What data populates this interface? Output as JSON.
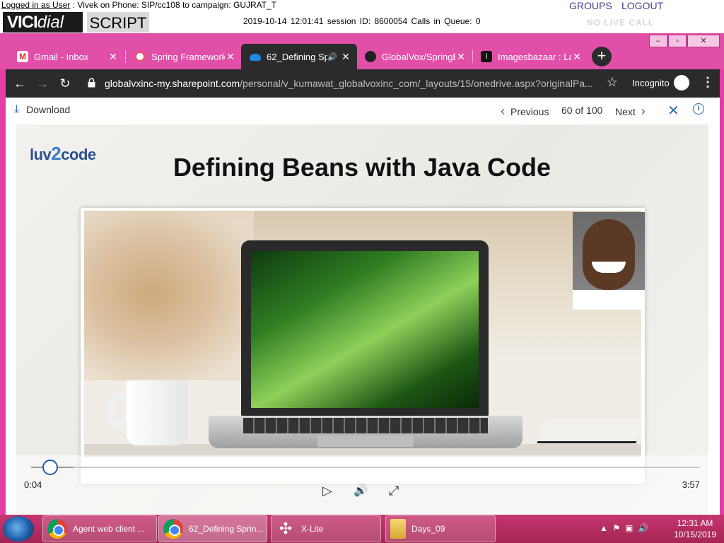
{
  "vici": {
    "logged_label": "Logged in as User",
    "logged_rest": " : Vivek on Phone: SIP/cc108  to campaign: GUJRAT_T",
    "logo_a": "VICI",
    "logo_b": "dial",
    "script_label": "SCRIPT",
    "status_line": "2019-10-14 12:01:41   session ID: 8600054   Calls in Queue: 0",
    "groups": "GROUPS",
    "logout": "LOGOUT",
    "no_live_call": "NO LIVE CALL"
  },
  "chrome": {
    "tabs": [
      {
        "label": "Gmail - Inbox",
        "favicon": "gmail-icon",
        "color": "#d93025"
      },
      {
        "label": "Spring Framework",
        "favicon": "spring-icon",
        "color": "#e2557a"
      },
      {
        "label": "62_Defining Sp",
        "favicon": "onedrive-icon",
        "color": "#1e88e5",
        "active": true
      },
      {
        "label": "GlobalVox/SpringB",
        "favicon": "github-icon",
        "color": "#222222"
      },
      {
        "label": "Imagesbazaar : Lar",
        "favicon": "imagesbazaar-icon",
        "color": "#111111"
      }
    ],
    "new_tab": "+",
    "url_host": "globalvxinc-my.sharepoint.com",
    "url_path": "/personal/v_kumawat_globalvoxinc_com/_layouts/15/onedrive.aspx?originalPa...",
    "incognito_label": "Incognito",
    "frame_color": "#e33ea6"
  },
  "viewer": {
    "download_label": "Download",
    "previous_label": "Previous",
    "counter": "60 of 100",
    "next_label": "Next"
  },
  "video": {
    "logo_text_a": "luv",
    "logo_text_b": "2",
    "logo_text_c": "code",
    "slide_title": "Defining Beans with Java Code",
    "current_time": "0:04",
    "total_time": "3:57",
    "progress_fraction": 0.017
  },
  "taskbar": {
    "items": [
      {
        "label": "Agent web client ...",
        "icon": "chrome-icon"
      },
      {
        "label": "62_Defining Sprin...",
        "icon": "chrome-icon"
      },
      {
        "label": "X-Lite",
        "icon": "xlite-icon"
      },
      {
        "label": "Days_09",
        "icon": "folder-icon"
      }
    ],
    "clock_time": "12:31 AM",
    "clock_date": "10/15/2019"
  }
}
